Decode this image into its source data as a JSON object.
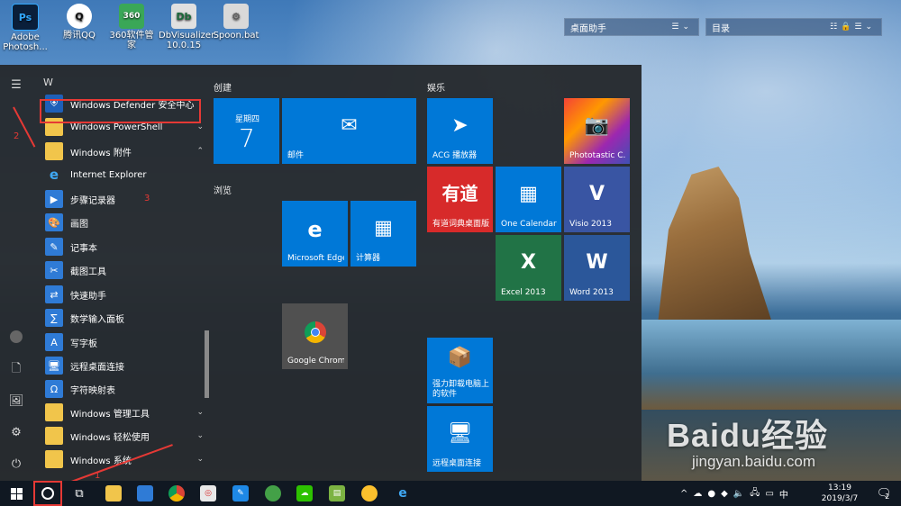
{
  "desktop": {
    "icons": [
      {
        "label": "Adobe Photosh...",
        "icon": "photoshop-icon",
        "glyph": "Ps"
      },
      {
        "label": "腾讯QQ",
        "icon": "qq-icon",
        "glyph": "Q"
      },
      {
        "label": "360软件管家",
        "icon": "360-icon",
        "glyph": "360"
      },
      {
        "label": "DbVisualizer 10.0.15",
        "icon": "dbvisualizer-icon",
        "glyph": "Db"
      },
      {
        "label": "Spoon.bat",
        "icon": "bat-file-icon",
        "glyph": "⚙"
      }
    ],
    "widgets": [
      {
        "title": "桌面助手"
      },
      {
        "title": "目录"
      }
    ]
  },
  "start_menu": {
    "letter": "W",
    "apps": [
      {
        "label": "Windows Defender 安全中心",
        "icon": "shield-icon",
        "expand": ""
      },
      {
        "label": "Windows PowerShell",
        "icon": "folder-icon",
        "expand": "⌄"
      },
      {
        "label": "Windows 附件",
        "icon": "folder-icon",
        "expand": "⌃"
      },
      {
        "label": "Internet Explorer",
        "icon": "internet-explorer-icon",
        "expand": ""
      },
      {
        "label": "步骤记录器",
        "icon": "steps-recorder-icon",
        "expand": ""
      },
      {
        "label": "画图",
        "icon": "paint-icon",
        "expand": ""
      },
      {
        "label": "记事本",
        "icon": "notepad-icon",
        "expand": ""
      },
      {
        "label": "截图工具",
        "icon": "snipping-tool-icon",
        "expand": ""
      },
      {
        "label": "快速助手",
        "icon": "quick-assist-icon",
        "expand": ""
      },
      {
        "label": "数学输入面板",
        "icon": "math-input-icon",
        "expand": ""
      },
      {
        "label": "写字板",
        "icon": "wordpad-icon",
        "expand": ""
      },
      {
        "label": "远程桌面连接",
        "icon": "remote-desktop-icon",
        "expand": ""
      },
      {
        "label": "字符映射表",
        "icon": "character-map-icon",
        "expand": ""
      },
      {
        "label": "Windows 管理工具",
        "icon": "folder-icon",
        "expand": "⌄"
      },
      {
        "label": "Windows 轻松使用",
        "icon": "folder-icon",
        "expand": "⌄"
      },
      {
        "label": "Windows 系统",
        "icon": "folder-icon",
        "expand": "⌄"
      }
    ],
    "groups": {
      "create": "创建",
      "browse": "浏览",
      "entertainment": "娱乐"
    },
    "tiles": {
      "calendar_day": "星期四",
      "calendar_date": "7",
      "mail": "邮件",
      "acg": "ACG 播放器",
      "youdao_logo": "有道",
      "youdao": "有道词典桌面版",
      "one_calendar": "One Calendar",
      "phototastic": "Phototastic C...",
      "visio": "Visio 2013",
      "edge": "Microsoft Edge",
      "calculator": "计算器",
      "excel": "Excel 2013",
      "word": "Word 2013",
      "chrome": "Google Chrome",
      "uninstall": "强力卸载电脑上的软件",
      "remote": "远程桌面连接"
    }
  },
  "annotations": {
    "step1": "1",
    "step2": "2",
    "step3": "3"
  },
  "taskbar": {
    "tray_lang": "中",
    "time": "13:19",
    "date": "2019/3/7",
    "notification_count": "2"
  },
  "watermark": {
    "big": "Baidu经验",
    "small": "jingyan.baidu.com"
  },
  "colors": {
    "accent": "#0078d7",
    "annotation": "#e53935",
    "taskbar": "#101822"
  }
}
